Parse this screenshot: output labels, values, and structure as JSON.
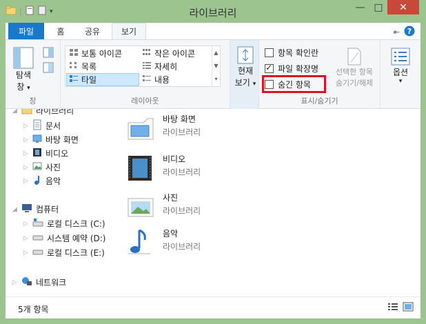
{
  "window": {
    "title": "라이브러리",
    "minimize_glyph": "—",
    "maximize_glyph": "□",
    "close_glyph": "✕"
  },
  "tabs": [
    {
      "label": "파일"
    },
    {
      "label": "홈"
    },
    {
      "label": "공유"
    },
    {
      "label": "보기"
    }
  ],
  "ribbon": {
    "nav_pane": {
      "label": "탐색",
      "label2": "창",
      "dropdown": "▾",
      "group_label": "창"
    },
    "layout": {
      "items": [
        {
          "label": "보통 아이콘"
        },
        {
          "label": "작은 아이콘"
        },
        {
          "label": "목록"
        },
        {
          "label": "자세히"
        },
        {
          "label": "타일",
          "selected": true
        },
        {
          "label": "내용"
        }
      ],
      "group_label": "레이아웃"
    },
    "current_view": {
      "label": "현재",
      "label2": "보기",
      "dropdown": "▾"
    },
    "show_hide": {
      "item_checkboxes": {
        "label": "항목 확인란",
        "checked": false
      },
      "file_extensions": {
        "label": "파일 확장명",
        "checked": true
      },
      "hidden_items": {
        "label": "숨긴 항목",
        "checked": false
      },
      "hide_selected": {
        "label": "선택한 항목",
        "label2": "숨기기/해제"
      },
      "group_label": "표시/숨기기"
    },
    "options": {
      "label": "옵션",
      "dropdown": "▾"
    }
  },
  "nav": {
    "libraries": "라이브러리",
    "items": [
      {
        "label": "문서",
        "icon": "document-icon"
      },
      {
        "label": "바탕 화면",
        "icon": "desktop-icon"
      },
      {
        "label": "비디오",
        "icon": "video-icon"
      },
      {
        "label": "사진",
        "icon": "picture-icon"
      },
      {
        "label": "음악",
        "icon": "music-icon"
      }
    ],
    "computer": "컴퓨터",
    "drives": [
      {
        "label": "로컬 디스크 (C:)"
      },
      {
        "label": "시스템 예약 (D:)"
      },
      {
        "label": "로컬 디스크 (E:)"
      }
    ],
    "network": "네트워크"
  },
  "content": {
    "tiles": [
      {
        "name": "바탕 화면",
        "type": "라이브러리"
      },
      {
        "name": "비디오",
        "type": "라이브러리"
      },
      {
        "name": "사진",
        "type": "라이브러리"
      },
      {
        "name": "음악",
        "type": "라이브러리"
      }
    ]
  },
  "status": {
    "count": "5개 항목"
  },
  "colors": {
    "frame": "#9bc48e",
    "file_tab": "#1979ca",
    "close": "#c9483a",
    "highlight": "#e01020",
    "selected": "#cde8ff"
  }
}
